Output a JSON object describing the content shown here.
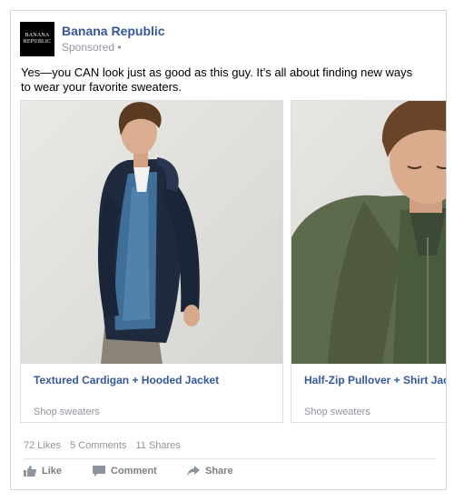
{
  "post": {
    "advertiser": {
      "name": "Banana Republic",
      "logo_line1": "BANANA",
      "logo_line2": "REPUBLIC",
      "sponsored": "Sponsored •"
    },
    "caption": "Yes—you CAN look just as good as this guy. It’s all about finding new ways to wear your favorite sweaters.",
    "carousel": [
      {
        "title": "Textured Cardigan + Hooded Jacket",
        "link_label": "Shop sweaters"
      },
      {
        "title": "Half-Zip Pullover + Shirt Jacket",
        "link_label": "Shop sweaters"
      }
    ],
    "stats": {
      "likes": "72 Likes",
      "comments": "5 Comments",
      "shares": "11 Shares"
    },
    "actions": {
      "like": "Like",
      "comment": "Comment",
      "share": "Share"
    }
  },
  "colors": {
    "link_blue": "#365899",
    "muted_gray": "#90949c",
    "border": "#d3d6db"
  }
}
